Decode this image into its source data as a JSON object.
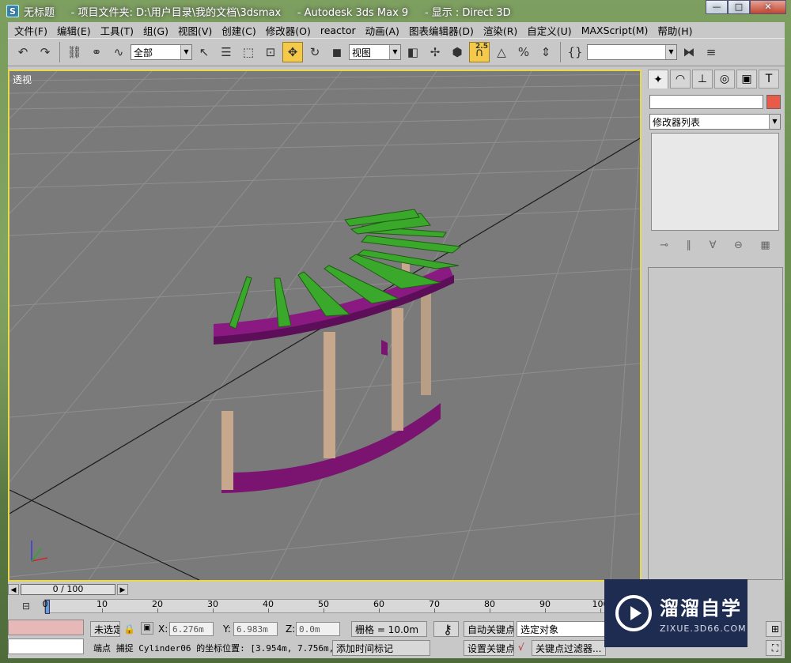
{
  "window": {
    "app_icon": "3dsmax-icon",
    "title": "无标题     - 项目文件夹: D:\\用户目录\\我的文档\\3dsmax     - Autodesk 3ds Max 9     - 显示 : Direct 3D",
    "minimize": "—",
    "maximize": "□",
    "close": "✕"
  },
  "menu": [
    "文件(F)",
    "编辑(E)",
    "工具(T)",
    "组(G)",
    "视图(V)",
    "创建(C)",
    "修改器(O)",
    "reactor",
    "动画(A)",
    "图表编辑器(D)",
    "渲染(R)",
    "自定义(U)",
    "MAXScript(M)",
    "帮助(H)"
  ],
  "toolbar": {
    "selection_filter": "全部",
    "reference_coord": "视图",
    "snap_value": "2.5",
    "named_selection": ""
  },
  "viewport": {
    "label": "透视"
  },
  "command_panel": {
    "modifier_list": "修改器列表",
    "name_value": "",
    "swatch_color": "#e85a4a"
  },
  "timeline": {
    "frame_display": "0 / 100",
    "ticks": [
      "0",
      "10",
      "20",
      "30",
      "40",
      "50",
      "60",
      "70",
      "80",
      "90",
      "100"
    ]
  },
  "status": {
    "selection_status": "未选定",
    "x_label": "X:",
    "x_value": "6.276m",
    "y_label": "Y:",
    "y_value": "6.983m",
    "z_label": "Z:",
    "z_value": "0.0m",
    "grid": "栅格 = 10.0m",
    "auto_key": "自动关键点",
    "selected_objects": "选定对象",
    "set_key": "设置关键点",
    "key_filters": "关键点过滤器...",
    "prompt": "端点  捕捉  Cylinder06 的坐标位置:  [3.954m, 7.756m,",
    "add_time_tag": "添加时间标记"
  },
  "watermark": {
    "title": "溜溜自学",
    "subtitle": "ZIXUE.3D66.COM"
  }
}
